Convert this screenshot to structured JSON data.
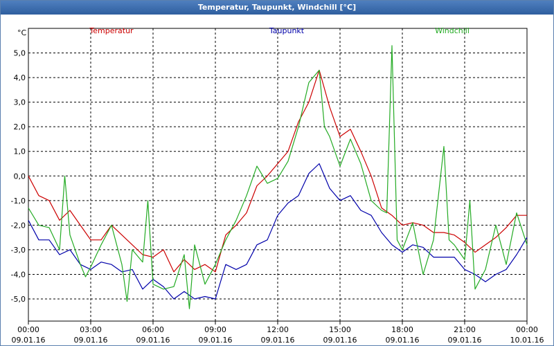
{
  "window": {
    "title": "Temperatur, Taupunkt, Windchill [°C]"
  },
  "chart_data": {
    "type": "line",
    "title": "Temperatur, Taupunkt, Windchill [°C]",
    "ylabel": "°C",
    "ylim": [
      -5.9,
      6.0
    ],
    "grid": true,
    "legend_placement": "top",
    "y_ticks": [
      "5,0",
      "4,0",
      "3,0",
      "2,0",
      "1,0",
      "0,0",
      "-1,0",
      "-2,0",
      "-3,0",
      "-4,0",
      "-5,0"
    ],
    "y_tick_values": [
      5,
      4,
      3,
      2,
      1,
      0,
      -1,
      -2,
      -3,
      -4,
      -5
    ],
    "x_ticks": [
      {
        "time": "00:00",
        "date": "09.01.16"
      },
      {
        "time": "03:00",
        "date": "09.01.16"
      },
      {
        "time": "06:00",
        "date": "09.01.16"
      },
      {
        "time": "09:00",
        "date": "09.01.16"
      },
      {
        "time": "12:00",
        "date": "09.01.16"
      },
      {
        "time": "15:00",
        "date": "09.01.16"
      },
      {
        "time": "18:00",
        "date": "09.01.16"
      },
      {
        "time": "21:00",
        "date": "09.01.16"
      },
      {
        "time": "00:00",
        "date": "10.01.16"
      }
    ],
    "x_range_hours": [
      0,
      24
    ],
    "series": [
      {
        "name": "Temperatur",
        "color": "#cc0000",
        "x_hours": [
          0,
          0.5,
          1,
          1.5,
          2,
          2.5,
          3,
          3.5,
          4,
          4.5,
          5,
          5.5,
          6,
          6.5,
          7,
          7.5,
          8,
          8.5,
          9,
          9.5,
          10,
          10.5,
          11,
          11.5,
          12,
          12.5,
          13,
          13.5,
          14,
          14.5,
          15,
          15.5,
          16,
          16.5,
          17,
          17.5,
          18,
          18.5,
          19,
          19.5,
          20,
          20.5,
          21,
          21.5,
          22,
          22.5,
          23,
          23.5,
          24
        ],
        "values": [
          0.0,
          -0.8,
          -1.0,
          -1.8,
          -1.4,
          -2.0,
          -2.6,
          -2.6,
          -2.0,
          -2.4,
          -2.8,
          -3.2,
          -3.3,
          -3.0,
          -3.9,
          -3.4,
          -3.8,
          -3.6,
          -3.9,
          -2.4,
          -2.0,
          -1.5,
          -0.4,
          0.0,
          0.5,
          1.0,
          2.2,
          3.0,
          4.3,
          2.8,
          1.6,
          1.9,
          1.0,
          0.0,
          -1.3,
          -1.6,
          -2.0,
          -1.9,
          -2.0,
          -2.3,
          -2.3,
          -2.4,
          -2.7,
          -3.1,
          -2.8,
          -2.5,
          -2.1,
          -1.6,
          -1.6
        ]
      },
      {
        "name": "Taupunkt",
        "color": "#0000aa",
        "x_hours": [
          0,
          0.5,
          1,
          1.5,
          2,
          2.5,
          3,
          3.5,
          4,
          4.5,
          5,
          5.5,
          6,
          6.5,
          7,
          7.5,
          8,
          8.5,
          9,
          9.5,
          10,
          10.5,
          11,
          11.5,
          12,
          12.5,
          13,
          13.5,
          14,
          14.5,
          15,
          15.5,
          16,
          16.5,
          17,
          17.5,
          18,
          18.5,
          19,
          19.5,
          20,
          20.5,
          21,
          21.5,
          22,
          22.5,
          23,
          23.5,
          24
        ],
        "values": [
          -1.8,
          -2.6,
          -2.6,
          -3.2,
          -3.0,
          -3.6,
          -3.8,
          -3.5,
          -3.6,
          -3.9,
          -3.8,
          -4.6,
          -4.2,
          -4.5,
          -5.0,
          -4.7,
          -5.0,
          -4.9,
          -5.0,
          -3.6,
          -3.8,
          -3.6,
          -2.8,
          -2.6,
          -1.6,
          -1.1,
          -0.8,
          0.1,
          0.5,
          -0.5,
          -1.0,
          -0.8,
          -1.4,
          -1.6,
          -2.3,
          -2.8,
          -3.1,
          -2.8,
          -2.9,
          -3.3,
          -3.3,
          -3.3,
          -3.8,
          -4.0,
          -4.3,
          -4.0,
          -3.8,
          -3.2,
          -2.5
        ]
      },
      {
        "name": "Windchill",
        "color": "#22aa22",
        "x_hours": [
          0,
          0.5,
          1,
          1.5,
          1.75,
          2,
          2.5,
          2.75,
          3,
          3.5,
          4,
          4.5,
          4.75,
          5,
          5.5,
          5.75,
          6,
          6.5,
          7,
          7.5,
          7.75,
          8,
          8.5,
          9,
          9.5,
          10,
          10.5,
          11,
          11.5,
          12,
          12.5,
          13,
          13.5,
          14,
          14.25,
          14.5,
          15,
          15.5,
          16,
          16.5,
          17,
          17.25,
          17.5,
          17.75,
          18,
          18.5,
          19,
          19.5,
          20,
          20.25,
          20.5,
          21,
          21.25,
          21.5,
          22,
          22.5,
          23,
          23.5,
          24
        ],
        "values": [
          -1.3,
          -2.0,
          -2.1,
          -3.0,
          0.0,
          -2.4,
          -3.6,
          -4.1,
          -3.7,
          -2.8,
          -2.0,
          -3.6,
          -5.1,
          -3.0,
          -3.5,
          -1.0,
          -4.4,
          -4.6,
          -4.5,
          -3.2,
          -5.4,
          -2.8,
          -4.4,
          -3.6,
          -2.6,
          -1.8,
          -0.8,
          0.4,
          -0.3,
          -0.1,
          0.6,
          2.0,
          3.8,
          4.3,
          2.0,
          1.6,
          0.4,
          1.5,
          0.5,
          -1.0,
          -1.4,
          -1.5,
          5.3,
          -2.6,
          -3.0,
          -1.9,
          -4.0,
          -2.6,
          1.2,
          -2.6,
          -2.8,
          -3.4,
          -1.0,
          -4.6,
          -3.8,
          -2.0,
          -3.6,
          -1.5,
          -2.8
        ]
      }
    ]
  }
}
